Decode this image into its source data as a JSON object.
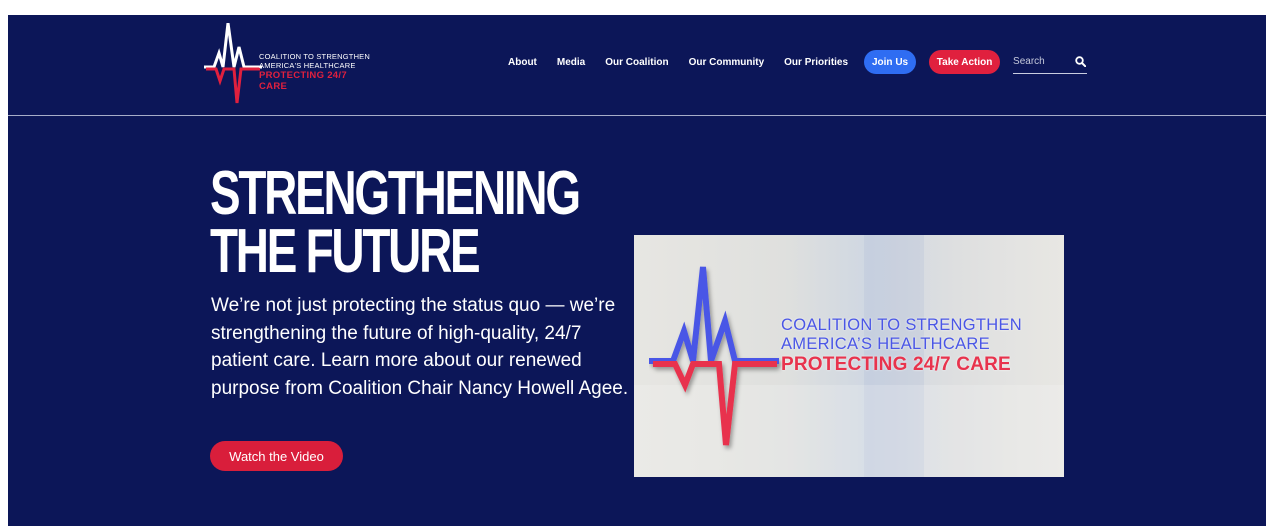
{
  "logo": {
    "line1": "COALITION TO STRENGTHEN",
    "line2": "AMERICA'S HEALTHCARE",
    "line3": "PROTECTING 24/7 CARE"
  },
  "nav": {
    "items": [
      {
        "label": "About"
      },
      {
        "label": "Media"
      },
      {
        "label": "Our Coalition"
      },
      {
        "label": "Our Community"
      },
      {
        "label": "Our Priorities"
      }
    ],
    "join_label": "Join Us",
    "action_label": "Take Action"
  },
  "search": {
    "placeholder": "Search",
    "value": ""
  },
  "hero": {
    "headline_line1": "STRENGTHENING",
    "headline_line2": "THE FUTURE",
    "body": "We’re not just protecting the status quo — we’re strengthening the future of high-quality, 24/7 patient care. Learn more about our renewed purpose from Coalition Chair Nancy Howell Agee.",
    "cta_label": "Watch the Video"
  },
  "video": {
    "line1": "COALITION TO STRENGTHEN",
    "line2": "AMERICA’S HEALTHCARE",
    "line3": "PROTECTING 24/7 CARE"
  },
  "icons": {
    "logo": "heartbeat-pulse-icon",
    "search": "search-icon"
  },
  "colors": {
    "background": "#0c1658",
    "accent_red": "#e0203e",
    "accent_blue": "#2f6df2",
    "text": "#ffffff"
  }
}
